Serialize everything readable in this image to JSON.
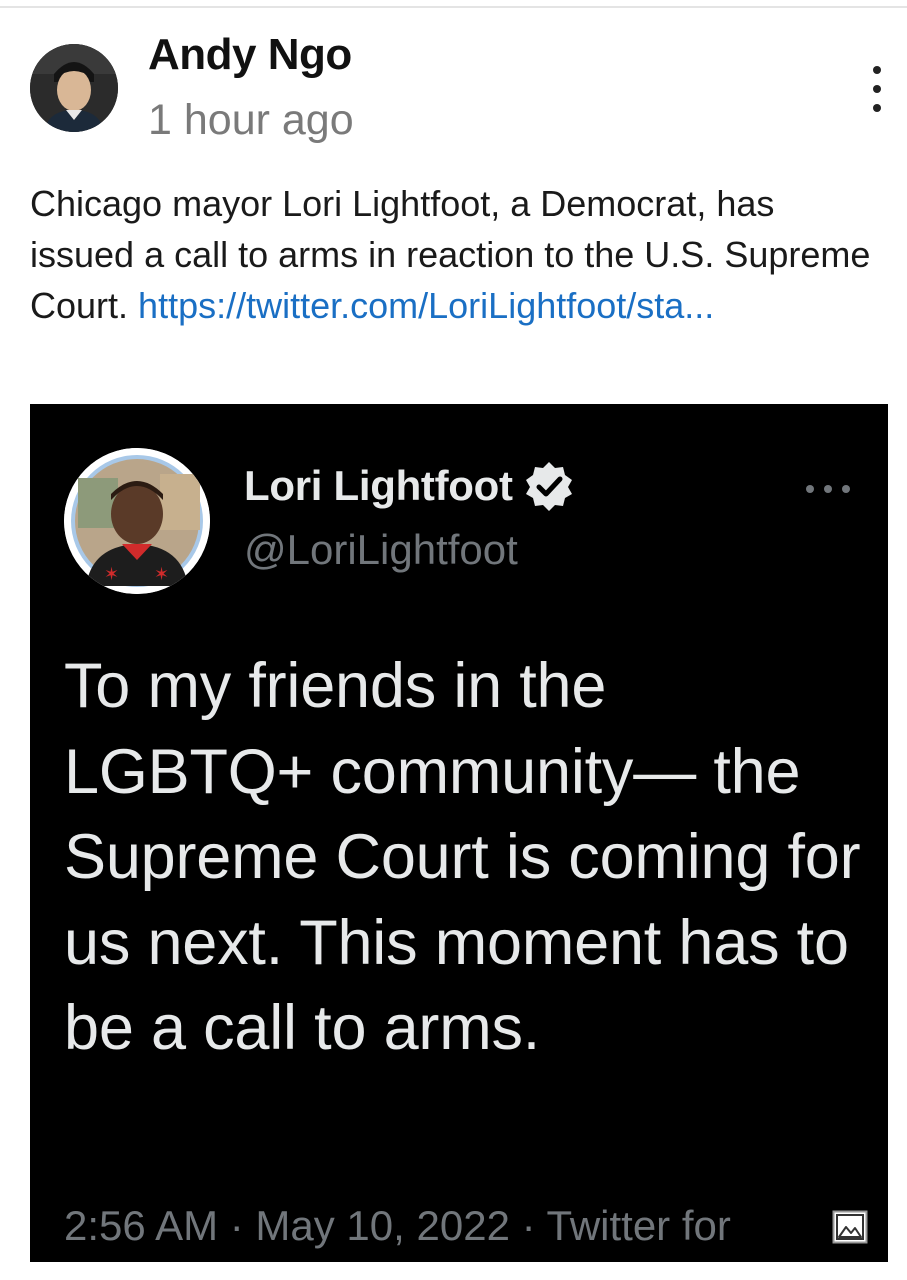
{
  "post": {
    "author_name": "Andy Ngo",
    "time": "1 hour ago",
    "text": "Chicago mayor Lori Lightfoot, a Democrat, has issued a call to arms in reaction to the U.S. Supreme Court. ",
    "link_text": "https://twitter.com/LoriLightfoot/sta..."
  },
  "tweet": {
    "display_name": "Lori Lightfoot",
    "handle": "@LoriLightfoot",
    "text": "To my friends in the LGBTQ+ community— the Supreme Court is coming for us next. This moment has to be a call to arms.",
    "meta": "2:56 AM · May 10, 2022 · Twitter for"
  },
  "icons": {
    "post_menu": "more-vertical-icon",
    "tweet_menu": "more-horizontal-icon",
    "verified": "verified-badge-icon",
    "media": "image-icon"
  },
  "colors": {
    "link": "#1a6fc4",
    "tweet_background": "#000000",
    "tweet_text": "#e7e9ea",
    "tweet_muted": "#71767b"
  }
}
